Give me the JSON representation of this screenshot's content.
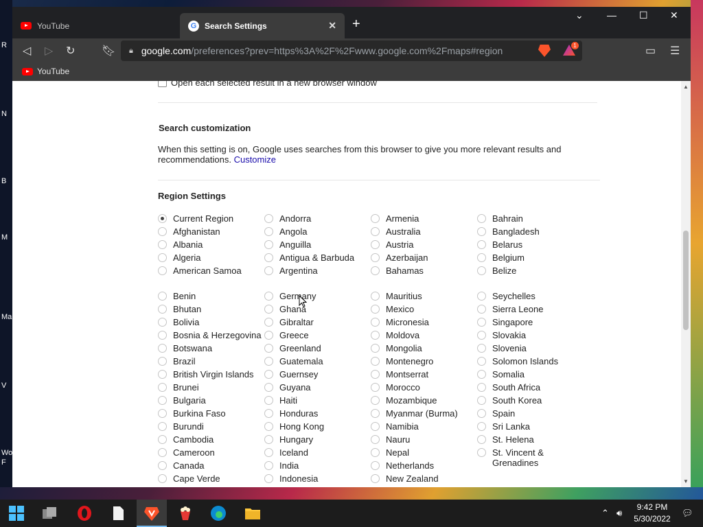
{
  "desktop": {
    "labels": [
      "R",
      "N",
      "B",
      "M",
      "Ma",
      "V",
      "Wo",
      "F"
    ]
  },
  "browser": {
    "tabs": [
      {
        "title": "YouTube",
        "active": false
      },
      {
        "title": "Search Settings",
        "active": true
      }
    ],
    "address": {
      "host": "google.com",
      "path": "/preferences?prev=https%3A%2F%2Fwww.google.com%2Fmaps#region"
    },
    "bookmarks": [
      {
        "label": "YouTube"
      }
    ],
    "rewards_badge": "1"
  },
  "page": {
    "open_new_window_label": "Open each selected result in a new browser window",
    "search_customization": {
      "heading": "Search customization",
      "text": "When this setting is on, Google uses searches from this browser to give you more relevant results and recommendations.",
      "link": "Customize"
    },
    "region_settings": {
      "heading": "Region Settings",
      "selected": "Current Region",
      "group1": [
        [
          "Current Region",
          "Afghanistan",
          "Albania",
          "Algeria",
          "American Samoa"
        ],
        [
          "Andorra",
          "Angola",
          "Anguilla",
          "Antigua & Barbuda",
          "Argentina"
        ],
        [
          "Armenia",
          "Australia",
          "Austria",
          "Azerbaijan",
          "Bahamas"
        ],
        [
          "Bahrain",
          "Bangladesh",
          "Belarus",
          "Belgium",
          "Belize"
        ]
      ],
      "group2": [
        [
          "Benin",
          "Bhutan",
          "Bolivia",
          "Bosnia & Herzegovina",
          "Botswana",
          "Brazil",
          "British Virgin Islands",
          "Brunei",
          "Bulgaria",
          "Burkina Faso",
          "Burundi",
          "Cambodia",
          "Cameroon",
          "Canada",
          "Cape Verde"
        ],
        [
          "Germany",
          "Ghana",
          "Gibraltar",
          "Greece",
          "Greenland",
          "Guatemala",
          "Guernsey",
          "Guyana",
          "Haiti",
          "Honduras",
          "Hong Kong",
          "Hungary",
          "Iceland",
          "India",
          "Indonesia"
        ],
        [
          "Mauritius",
          "Mexico",
          "Micronesia",
          "Moldova",
          "Mongolia",
          "Montenegro",
          "Montserrat",
          "Morocco",
          "Mozambique",
          "Myanmar (Burma)",
          "Namibia",
          "Nauru",
          "Nepal",
          "Netherlands",
          "New Zealand"
        ],
        [
          "Seychelles",
          "Sierra Leone",
          "Singapore",
          "Slovakia",
          "Slovenia",
          "Solomon Islands",
          "Somalia",
          "South Africa",
          "South Korea",
          "Spain",
          "Sri Lanka",
          "St. Helena",
          "St. Vincent & Grenadines"
        ]
      ]
    }
  },
  "taskbar": {
    "time": "9:42 PM",
    "date": "5/30/2022",
    "icons": [
      "windows-start-icon",
      "file-explorer-icon",
      "opera-icon",
      "notepad-icon",
      "brave-icon",
      "popcorn-icon",
      "edge-icon",
      "folder-icon"
    ]
  },
  "colors": {
    "accent": "#1a0dab",
    "tab_active": "#3c3c3c",
    "brave": "#fb542b"
  }
}
